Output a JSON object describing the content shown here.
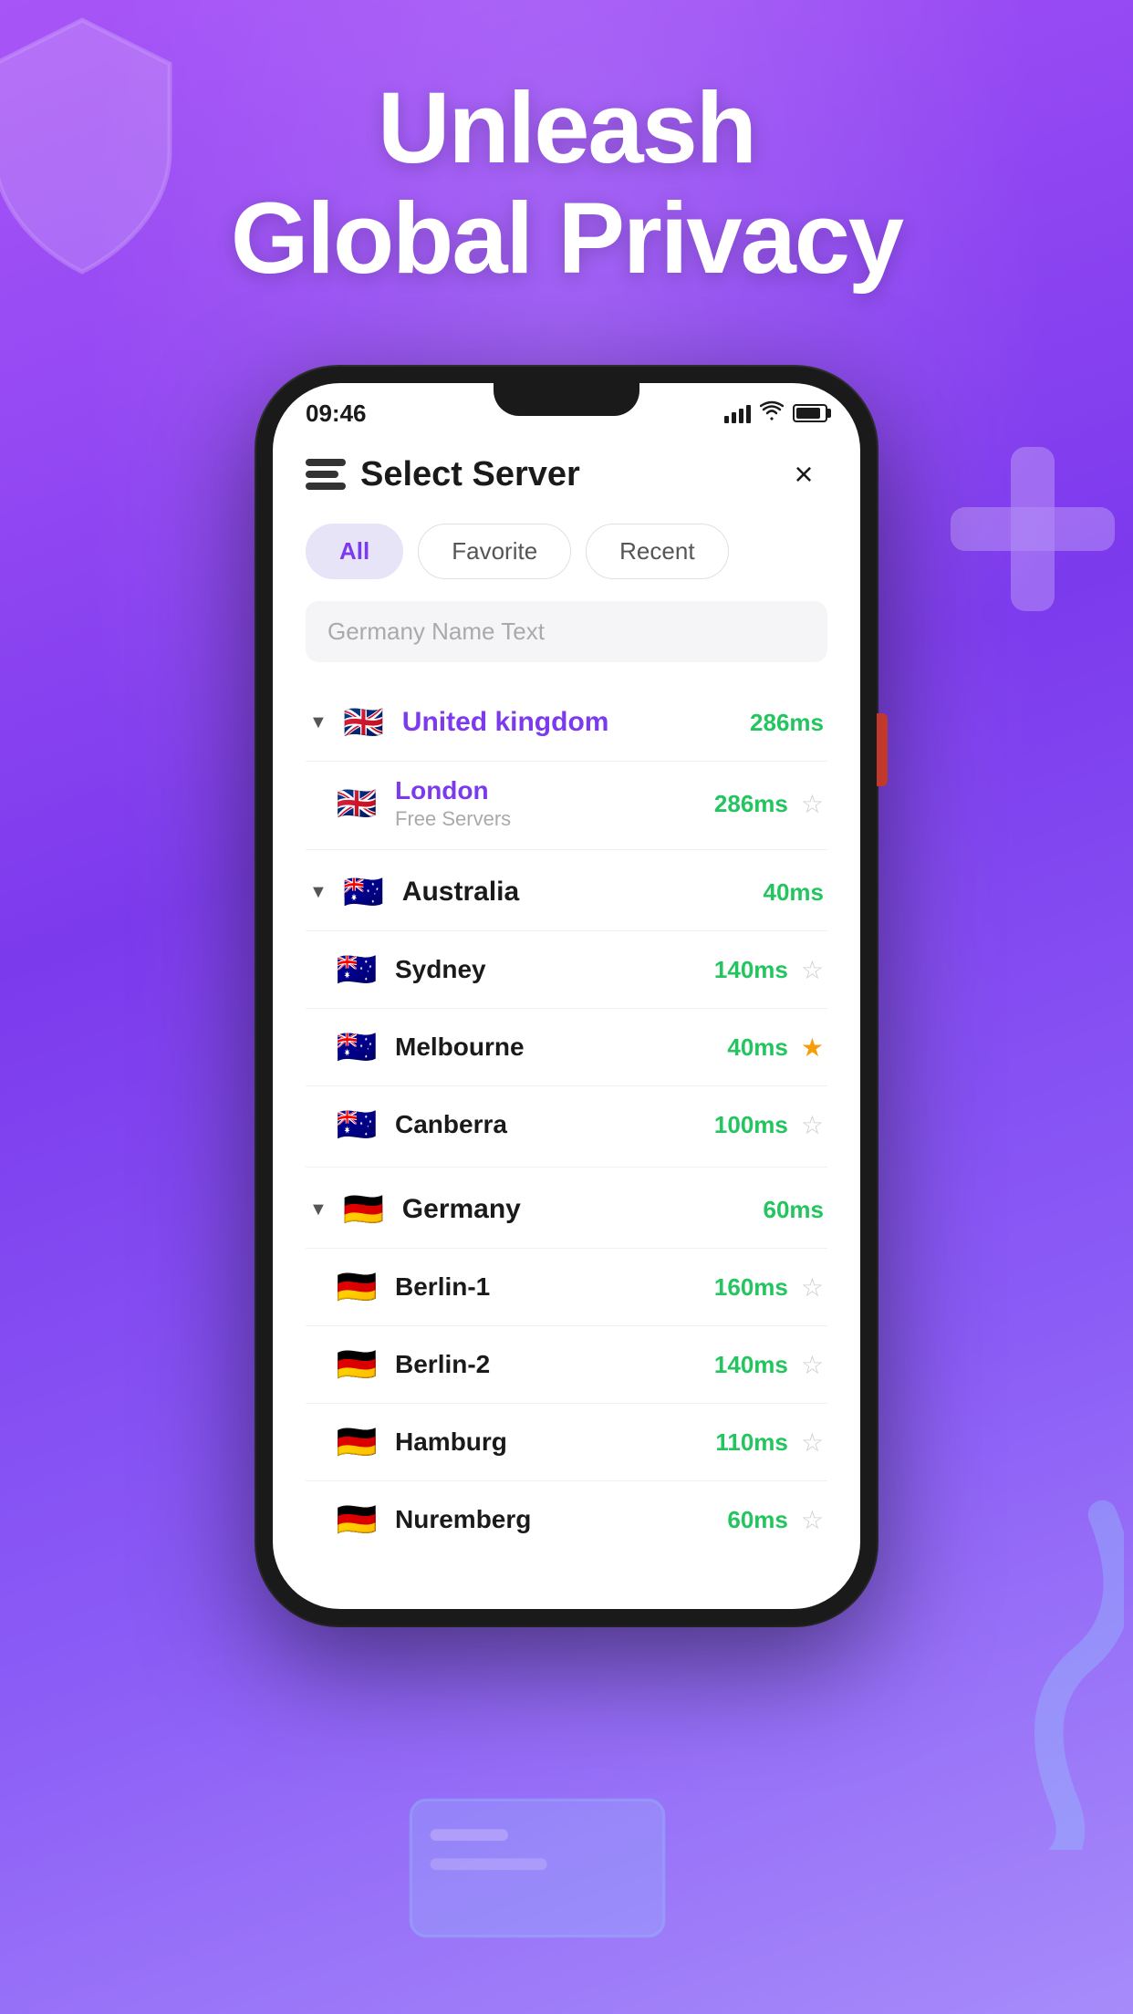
{
  "page": {
    "background_color": "#8b5cf6",
    "headline_line1": "Unleash",
    "headline_line2": "Global Privacy"
  },
  "status_bar": {
    "time": "09:46",
    "signal_label": "signal",
    "wifi_label": "wifi",
    "battery_label": "battery"
  },
  "header": {
    "icon_label": "server-icon",
    "title": "Select Server",
    "close_label": "×"
  },
  "tabs": [
    {
      "label": "All",
      "active": true
    },
    {
      "label": "Favorite",
      "active": false
    },
    {
      "label": "Recent",
      "active": false
    }
  ],
  "search": {
    "placeholder": "Germany Name Text"
  },
  "countries": [
    {
      "name": "United kingdom",
      "flag": "🇬🇧",
      "latency": "286ms",
      "expanded": true,
      "cities": [
        {
          "name": "London",
          "subtitle": "Free Servers",
          "latency": "286ms",
          "starred": false,
          "flag": "🇬🇧"
        }
      ]
    },
    {
      "name": "Australia",
      "flag": "🇦🇺",
      "latency": "40ms",
      "expanded": true,
      "cities": [
        {
          "name": "Sydney",
          "subtitle": "",
          "latency": "140ms",
          "starred": false,
          "flag": "🇦🇺"
        },
        {
          "name": "Melbourne",
          "subtitle": "",
          "latency": "40ms",
          "starred": true,
          "flag": "🇦🇺"
        },
        {
          "name": "Canberra",
          "subtitle": "",
          "latency": "100ms",
          "starred": false,
          "flag": "🇦🇺"
        }
      ]
    },
    {
      "name": "Germany",
      "flag": "🇩🇪",
      "latency": "60ms",
      "expanded": true,
      "cities": [
        {
          "name": "Berlin-1",
          "subtitle": "",
          "latency": "160ms",
          "starred": false,
          "flag": "🇩🇪"
        },
        {
          "name": "Berlin-2",
          "subtitle": "",
          "latency": "140ms",
          "starred": false,
          "flag": "🇩🇪"
        },
        {
          "name": "Hamburg",
          "subtitle": "",
          "latency": "110ms",
          "starred": false,
          "flag": "🇩🇪"
        },
        {
          "name": "Nuremberg",
          "subtitle": "",
          "latency": "60ms",
          "starred": false,
          "flag": "🇩🇪"
        }
      ]
    }
  ]
}
